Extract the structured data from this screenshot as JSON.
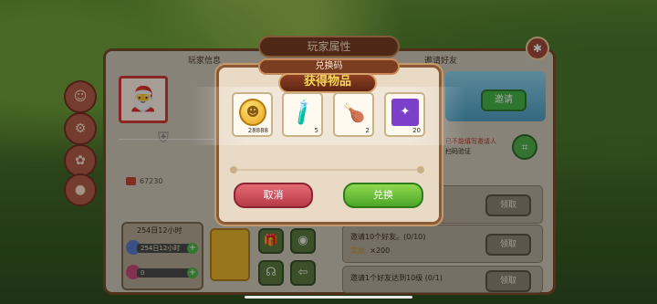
{
  "main_panel": {
    "title": "玩家属性",
    "tab_left": "玩家信息",
    "tab_right": "邀请好友",
    "close_icon": "gear-icon",
    "score": "67230",
    "time_label": "254日12小时",
    "mini_bar_1": "254日12小时",
    "mini_bar_2": "0",
    "invite_button": "邀请",
    "qr_text_1": "已不能填写邀请人",
    "qr_text_2": "扫码验证",
    "tasks": [
      {
        "text": "",
        "reward": "",
        "claim": "领取"
      },
      {
        "text": "邀请10个好友。(0/10)",
        "reward_label": "奖励:",
        "reward": "×200",
        "claim": "领取"
      },
      {
        "text": "邀请1个好友达到10级 (0/1)",
        "claim": "领取"
      }
    ]
  },
  "redeem_dialog": {
    "title": "兑换码",
    "cancel_button": "取消",
    "redeem_button": "兑换"
  },
  "reward_popup": {
    "title": "获得物品",
    "items": [
      {
        "icon": "gold-coin-icon",
        "glyph": "☻",
        "count": "28888"
      },
      {
        "icon": "potion-tube-icon",
        "glyph": "🧪",
        "count": "5"
      },
      {
        "icon": "fried-chicken-bucket-icon",
        "glyph": "🍗",
        "count": "2"
      },
      {
        "icon": "purple-ticket-icon",
        "glyph": "✦",
        "count": "20"
      }
    ]
  },
  "colors": {
    "accent_green": "#4ca528",
    "accent_red": "#b83a48",
    "title_gold": "#ffd95a"
  }
}
